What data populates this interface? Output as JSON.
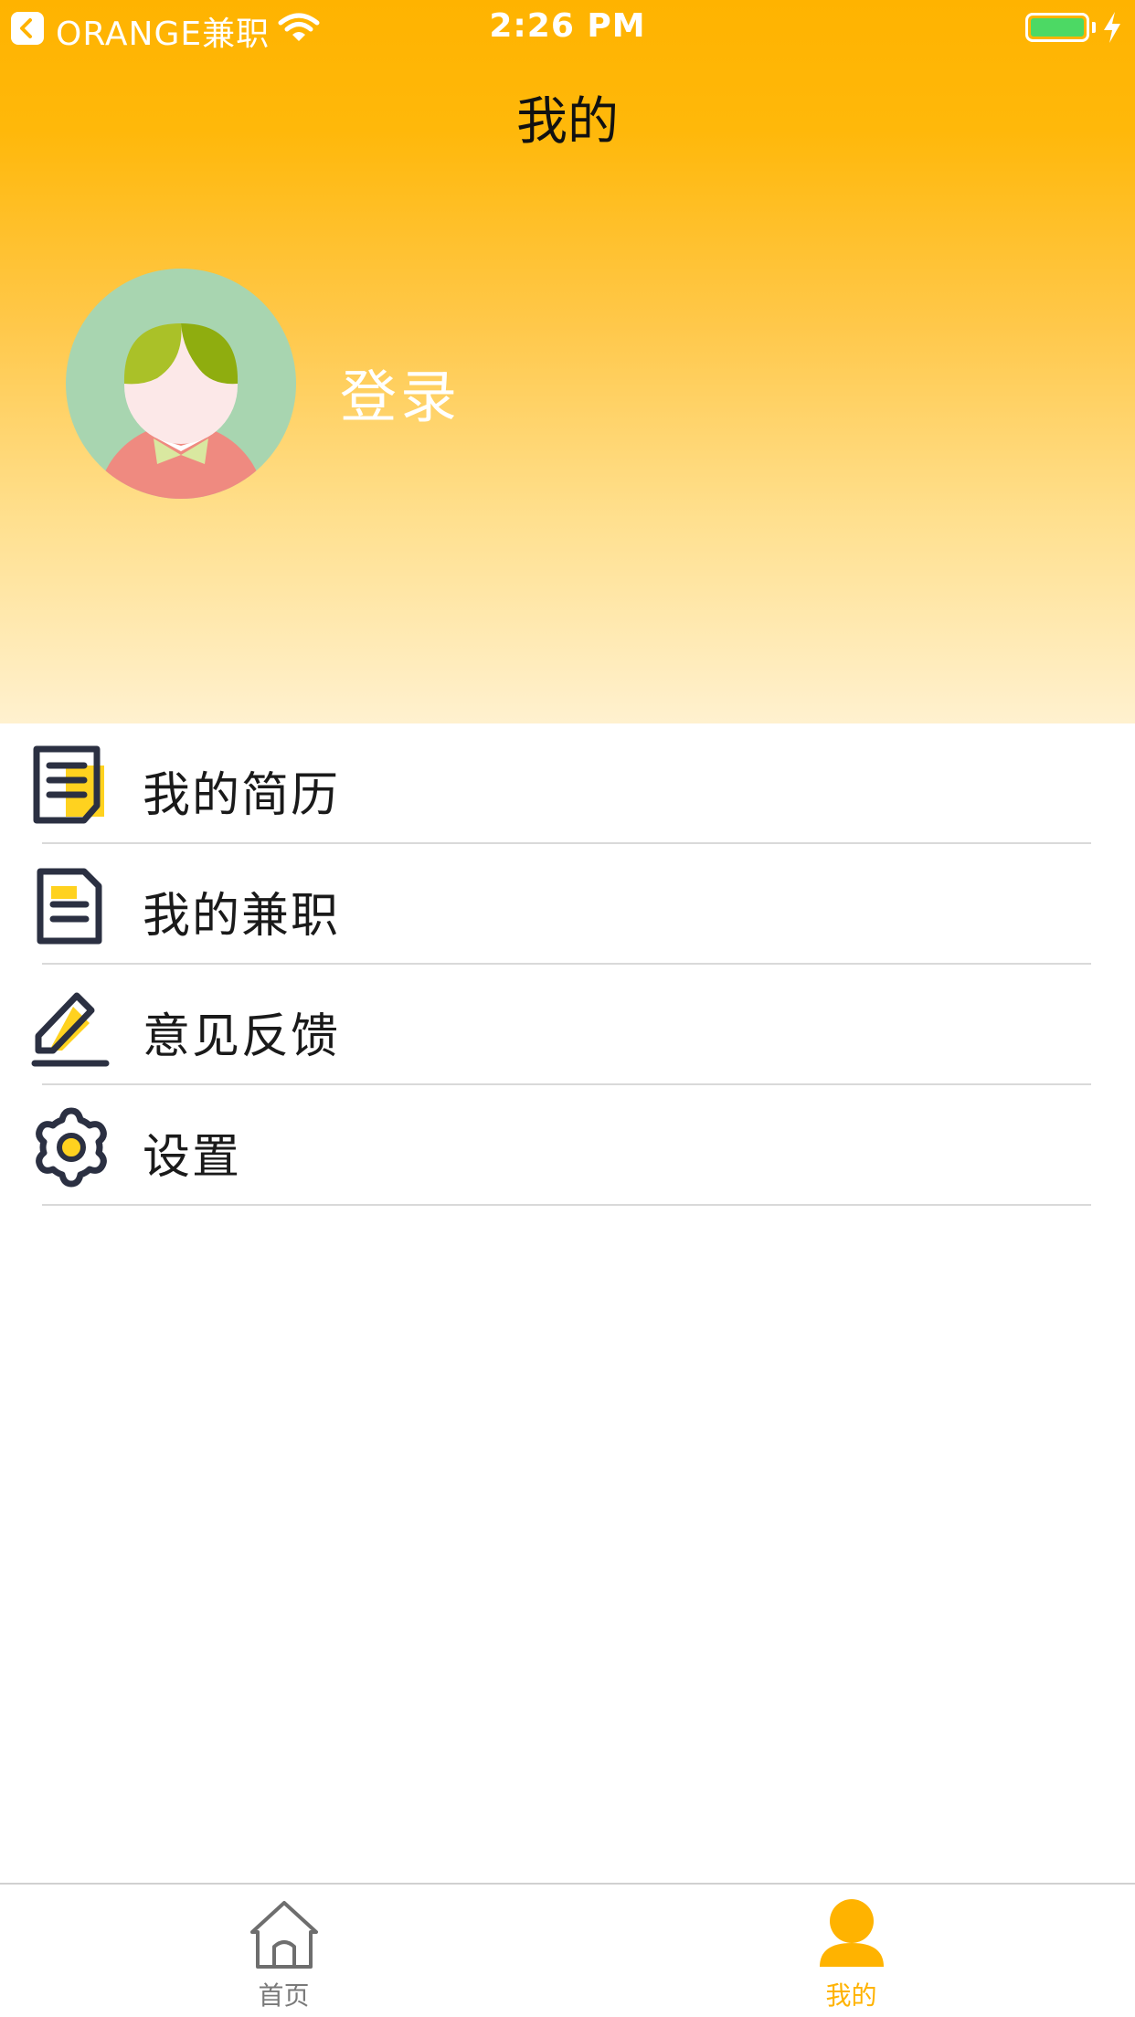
{
  "status_bar": {
    "carrier": "ORANGE兼职",
    "time": "2:26 PM"
  },
  "nav": {
    "title": "我的"
  },
  "profile": {
    "login_label": "登录"
  },
  "menu": {
    "items": [
      {
        "label": "我的简历",
        "icon": "resume-icon"
      },
      {
        "label": "我的兼职",
        "icon": "part-time-jobs-icon"
      },
      {
        "label": "意见反馈",
        "icon": "feedback-edit-icon"
      },
      {
        "label": "设置",
        "icon": "settings-gear-icon"
      }
    ]
  },
  "tab_bar": {
    "tabs": [
      {
        "label": "首页",
        "icon": "home-icon",
        "active": false
      },
      {
        "label": "我的",
        "icon": "person-icon",
        "active": true
      }
    ]
  },
  "colors": {
    "accent": "#ffb300",
    "icon_dark": "#2b3042",
    "icon_highlight": "#ffd21f",
    "battery": "#4cd964"
  }
}
